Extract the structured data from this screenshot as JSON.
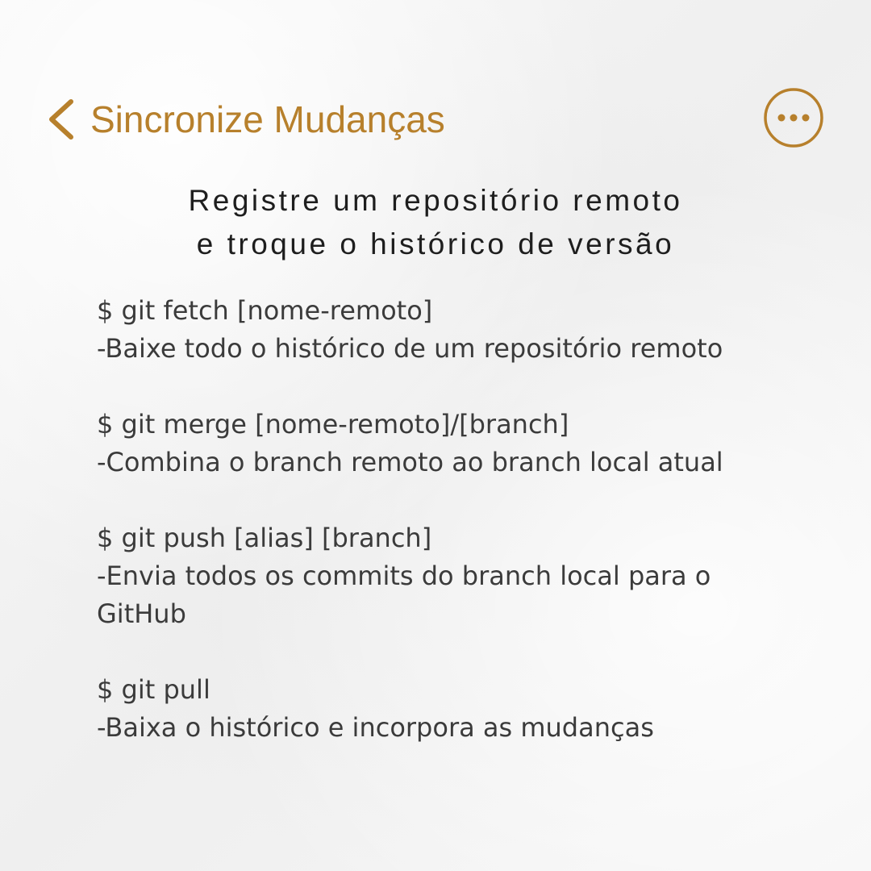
{
  "header": {
    "title": "Sincronize Mudanças",
    "back_icon": "chevron-left-icon",
    "more_icon": "ellipsis-circle-icon"
  },
  "subtitle": {
    "line1": "Registre um repositório remoto",
    "line2": "e troque o histórico de versão"
  },
  "commands": [
    {
      "command": "$ git fetch [nome-remoto]",
      "description": "-Baixe todo o histórico de um repositório remoto"
    },
    {
      "command": "$ git merge [nome-remoto]/[branch]",
      "description": "-Combina o branch remoto ao branch local atual"
    },
    {
      "command": "$ git push [alias] [branch]",
      "description": "-Envia todos os commits do branch local para o GitHub"
    },
    {
      "command": "$ git pull",
      "description": "-Baixa o histórico e incorpora as mudanças"
    }
  ],
  "colors": {
    "accent": "#b7802c",
    "heading_text": "#1e1e1e",
    "body_text": "#3b3b3b",
    "background": "#f4f4f4"
  }
}
